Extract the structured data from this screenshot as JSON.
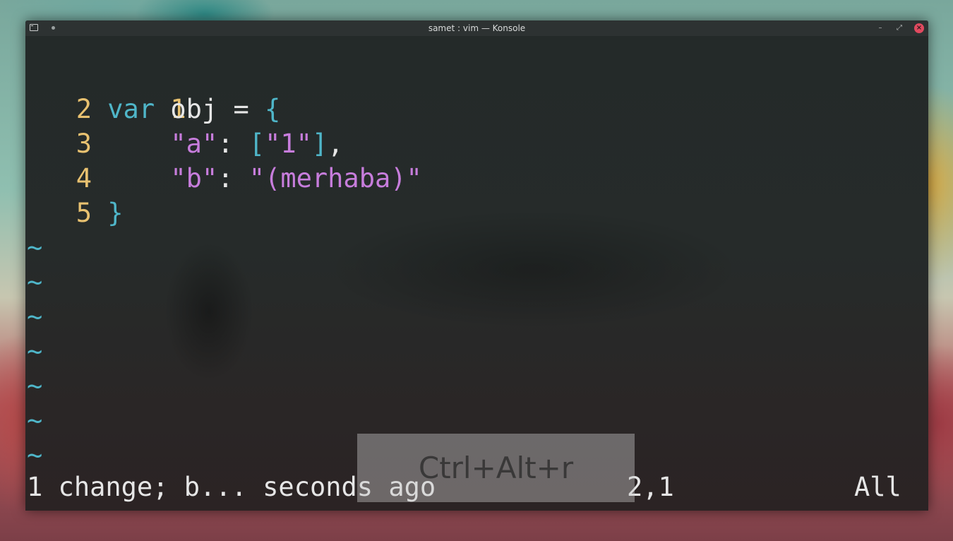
{
  "window": {
    "title": "samet : vim — Konsole",
    "buttons": {
      "minimize": "–",
      "maximize": "⤢",
      "close": "×"
    }
  },
  "editor": {
    "lines": [
      {
        "number": "1",
        "text": ""
      },
      {
        "number": "2",
        "kw": "var",
        "text": " obj = ",
        "brace": "{"
      },
      {
        "number": "3",
        "indent": "    ",
        "key": "\"a\"",
        "colon": ": ",
        "bracket_open": "[",
        "value": "\"1\"",
        "bracket_close": "]",
        "comma": ","
      },
      {
        "number": "4",
        "indent": "    ",
        "key": "\"b\"",
        "colon": ": ",
        "value": "\"(merhaba)\""
      },
      {
        "number": "5",
        "brace": "}"
      }
    ],
    "empty_marker": "~",
    "status_message": "1 change; b... seconds ago",
    "cursor_position": "2,1",
    "scroll_indicator": "All"
  },
  "key_overlay": {
    "keys": "Ctrl+Alt+r"
  },
  "colors": {
    "line_number": "#e8c170",
    "keyword": "#4fb6c9",
    "string": "#c77ddc",
    "text": "#e6e6e6",
    "close_button": "#e04a5f"
  }
}
